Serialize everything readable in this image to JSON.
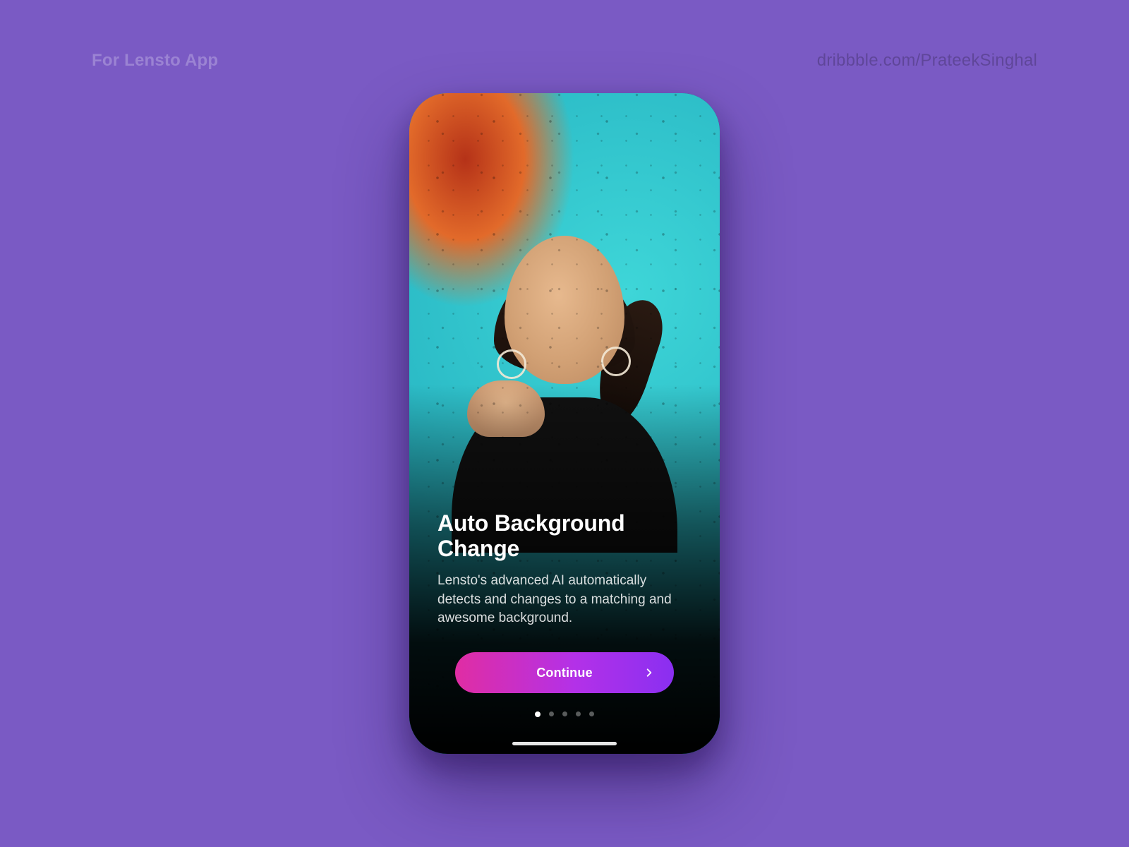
{
  "page": {
    "header_left": "For Lensto App",
    "header_right": "dribbble.com/PrateekSinghal"
  },
  "onboarding": {
    "title": "Auto Background Change",
    "description": "Lensto's advanced AI automatically detects and changes to a matching and awesome background.",
    "cta_label": "Continue",
    "cta_icon": "chevron-right",
    "page_count": 5,
    "active_page_index": 0
  },
  "colors": {
    "background": "#7a5ac4",
    "cta_gradient_start": "#e02da3",
    "cta_gradient_end": "#8a2ff1"
  }
}
